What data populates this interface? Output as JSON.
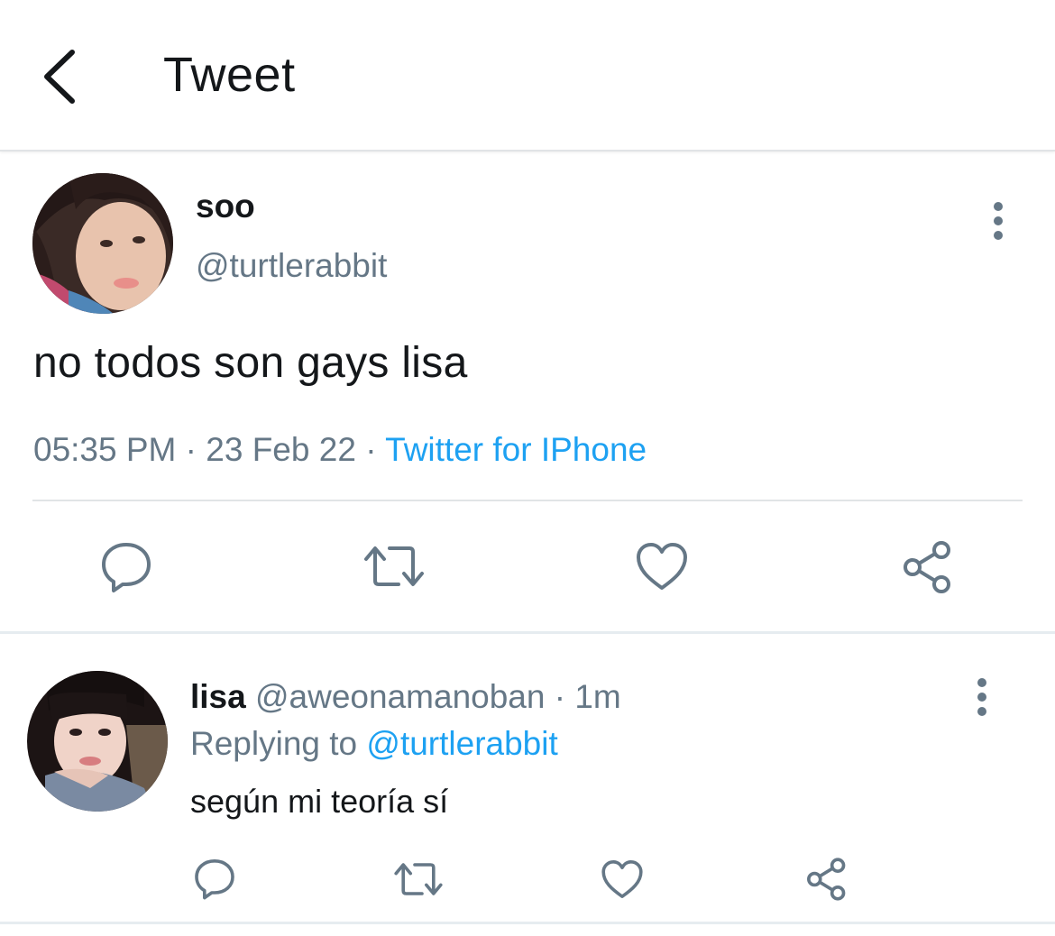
{
  "header": {
    "title": "Tweet",
    "back_icon": "chevron-left-icon"
  },
  "tweet": {
    "name": "soo",
    "handle": "@turtlerabbit",
    "text": "no todos son gays lisa",
    "time": "05:35 PM",
    "date": "23 Feb 22",
    "source": "Twitter for IPhone",
    "separator": "·",
    "actions": [
      "reply-icon",
      "retweet-icon",
      "like-icon",
      "share-icon"
    ]
  },
  "reply": {
    "name": "lisa",
    "handle": "@aweonamanoban",
    "age": "1m",
    "separator": "·",
    "replying_label": "Replying to",
    "replying_to": "@turtlerabbit",
    "text": "según mi teoría sí",
    "actions": [
      "reply-icon",
      "retweet-icon",
      "like-icon",
      "share-icon"
    ]
  },
  "colors": {
    "text": "#14171a",
    "secondary": "#657786",
    "link": "#1da1f2",
    "divider": "#e1e4e6"
  }
}
